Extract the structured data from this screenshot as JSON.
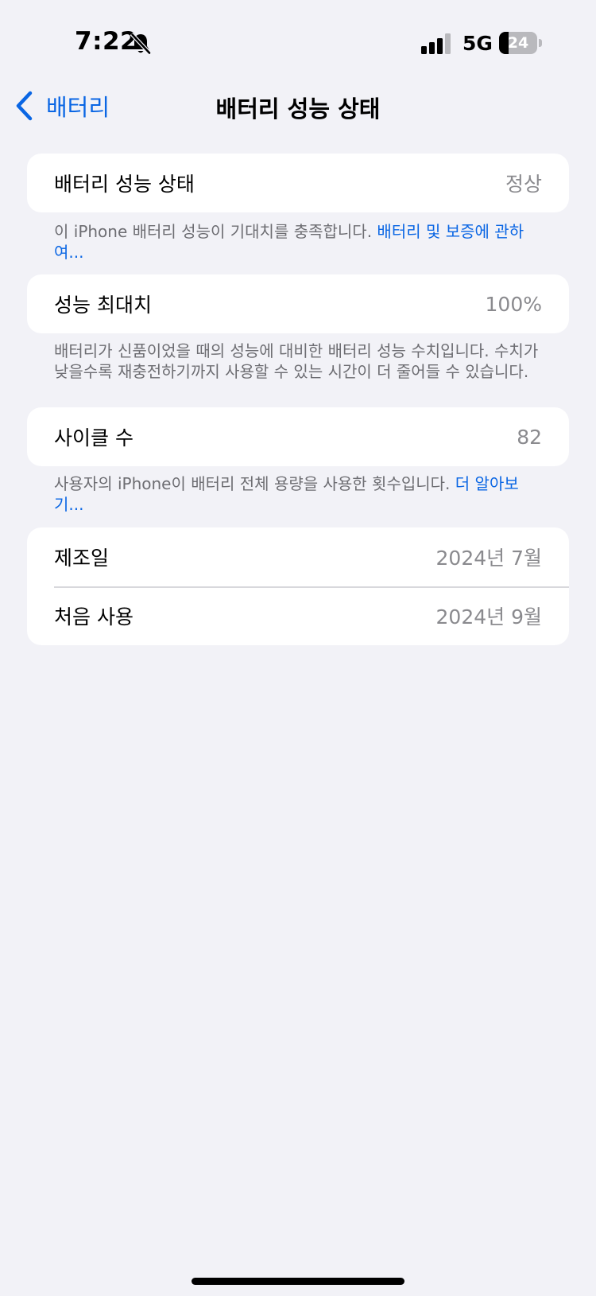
{
  "status_bar": {
    "time": "7:22",
    "network": "5G",
    "battery_level": "24",
    "battery_fraction": 0.24
  },
  "nav": {
    "back_label": "배터리",
    "title": "배터리 성능 상태"
  },
  "sections": {
    "health": {
      "label": "배터리 성능 상태",
      "value": "정상",
      "footer_text": "이 iPhone 배터리 성능이 기대치를 충족합니다. ",
      "footer_link": "배터리 및 보증에 관하여..."
    },
    "capacity": {
      "label": "성능 최대치",
      "value": "100%",
      "footer_text": "배터리가 신품이었을 때의 성능에 대비한 배터리 성능 수치입니다. 수치가 낮을수록 재충전하기까지 사용할 수 있는 시간이 더 줄어들 수 있습니다."
    },
    "cycles": {
      "label": "사이클 수",
      "value": "82",
      "footer_text": "사용자의 iPhone이 배터리 전체 용량을 사용한 횟수입니다. ",
      "footer_link": "더 알아보기..."
    },
    "dates": {
      "manufacture_label": "제조일",
      "manufacture_value": "2024년 7월",
      "first_use_label": "처음 사용",
      "first_use_value": "2024년 9월"
    }
  },
  "colors": {
    "accent": "#0a66e4",
    "background": "#f2f2f7",
    "secondary_text": "#8a8a8e"
  },
  "icons": {
    "back": "chevron-left-icon",
    "silent": "bell-slash-icon",
    "signal": "cellular-signal-icon",
    "battery": "battery-icon"
  }
}
